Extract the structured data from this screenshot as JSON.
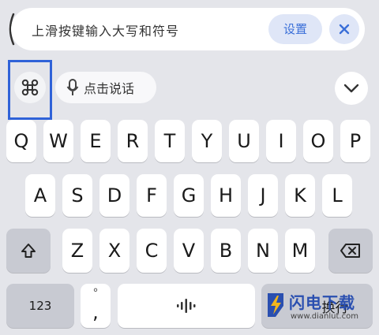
{
  "hint": {
    "text": "上滑按键输入大写和符号",
    "settings_label": "设置"
  },
  "toolbar": {
    "voice_label": "点击说话"
  },
  "keyboard": {
    "row1": [
      "Q",
      "W",
      "E",
      "R",
      "T",
      "Y",
      "U",
      "I",
      "O",
      "P"
    ],
    "row2": [
      "A",
      "S",
      "D",
      "F",
      "G",
      "H",
      "J",
      "K",
      "L"
    ],
    "row3": [
      "Z",
      "X",
      "C",
      "V",
      "B",
      "N",
      "M"
    ],
    "num_label": "123",
    "punct_main": ",",
    "punct_sub": "°",
    "enter_label": "换行"
  },
  "watermark": {
    "title": "闪电下载",
    "url": "www.dianlut.com"
  },
  "colors": {
    "accent": "#3a6fd8",
    "highlight_border": "#2f62d8",
    "background": "#e4e5ea"
  }
}
